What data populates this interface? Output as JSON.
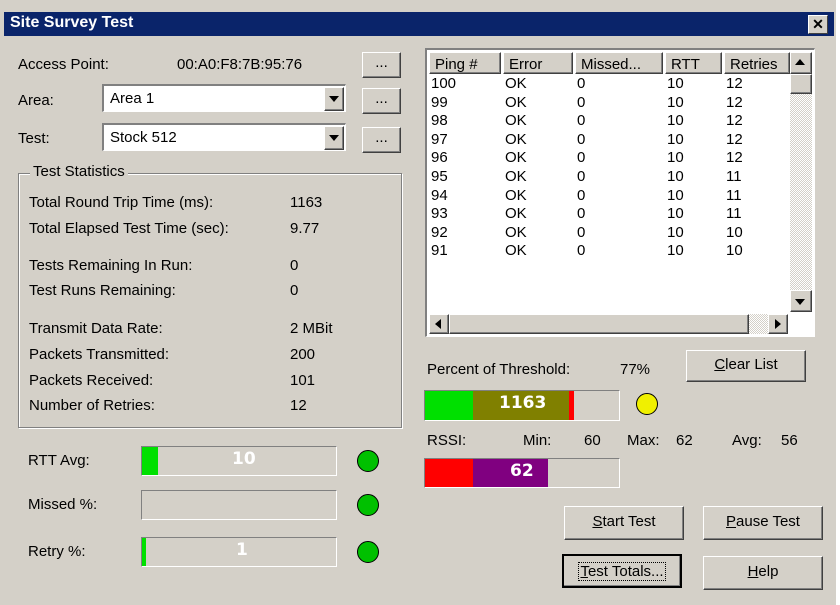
{
  "window": {
    "title": "Site Survey Test"
  },
  "access_point": {
    "label": "Access Point:",
    "value": "00:A0:F8:7B:95:76",
    "browse_label": "..."
  },
  "area": {
    "label": "Area:",
    "value": "Area 1",
    "browse_label": "..."
  },
  "test": {
    "label": "Test:",
    "value": "Stock 512",
    "browse_label": "..."
  },
  "stats": {
    "title": "Test Statistics",
    "rows": [
      {
        "label": "Total Round Trip Time (ms):",
        "value": "1163"
      },
      {
        "label": "Total Elapsed Test Time (sec):",
        "value": "9.77"
      },
      {
        "label": "Tests Remaining In Run:",
        "value": "0"
      },
      {
        "label": "Test Runs Remaining:",
        "value": "0"
      },
      {
        "label": "Transmit Data Rate:",
        "value": "2 MBit"
      },
      {
        "label": "Packets Transmitted:",
        "value": "200"
      },
      {
        "label": "Packets Received:",
        "value": "101"
      },
      {
        "label": "Number of Retries:",
        "value": "12"
      }
    ]
  },
  "meters": {
    "rtt": {
      "label": "RTT Avg:",
      "value": "10",
      "fill_fraction": 0.08,
      "led_color": "#00c000"
    },
    "missed": {
      "label": "Missed %:",
      "value": "",
      "fill_fraction": 0,
      "led_color": "#00c000"
    },
    "retry": {
      "label": "Retry %:",
      "value": "1",
      "fill_fraction": 0.02,
      "led_color": "#00c000"
    }
  },
  "ping_list": {
    "columns": [
      "Ping #",
      "Error",
      "Missed...",
      "RTT",
      "Retries"
    ],
    "rows": [
      [
        "100",
        "OK",
        "0",
        "10",
        "12"
      ],
      [
        "99",
        "OK",
        "0",
        "10",
        "12"
      ],
      [
        "98",
        "OK",
        "0",
        "10",
        "12"
      ],
      [
        "97",
        "OK",
        "0",
        "10",
        "12"
      ],
      [
        "96",
        "OK",
        "0",
        "10",
        "12"
      ],
      [
        "95",
        "OK",
        "0",
        "10",
        "11"
      ],
      [
        "94",
        "OK",
        "0",
        "10",
        "11"
      ],
      [
        "93",
        "OK",
        "0",
        "10",
        "11"
      ],
      [
        "92",
        "OK",
        "0",
        "10",
        "10"
      ],
      [
        "91",
        "OK",
        "0",
        "10",
        "10"
      ]
    ]
  },
  "threshold": {
    "label": "Percent of Threshold:",
    "percent": "77%",
    "value": "1163",
    "fill_fraction": 0.77,
    "led_color": "#f0f000",
    "colors": {
      "low": "#00e000",
      "mid": "#808000",
      "high": "#ff0000"
    }
  },
  "rssi": {
    "label": "RSSI:",
    "min_label": "Min:",
    "min": "60",
    "max_label": "Max:",
    "max": "62",
    "avg_label": "Avg:",
    "avg": "56",
    "value": "62",
    "colors": {
      "low": "#ff0000",
      "mid": "#800080"
    }
  },
  "buttons": {
    "clear_list": {
      "underlined": "C",
      "rest": "lear List"
    },
    "start_test": {
      "underlined": "S",
      "rest": "tart Test"
    },
    "pause_test": {
      "underlined": "P",
      "rest": "ause Test"
    },
    "test_totals": {
      "underlined": "T",
      "rest": "est Totals..."
    },
    "help": {
      "underlined": "H",
      "rest": "elp"
    }
  }
}
